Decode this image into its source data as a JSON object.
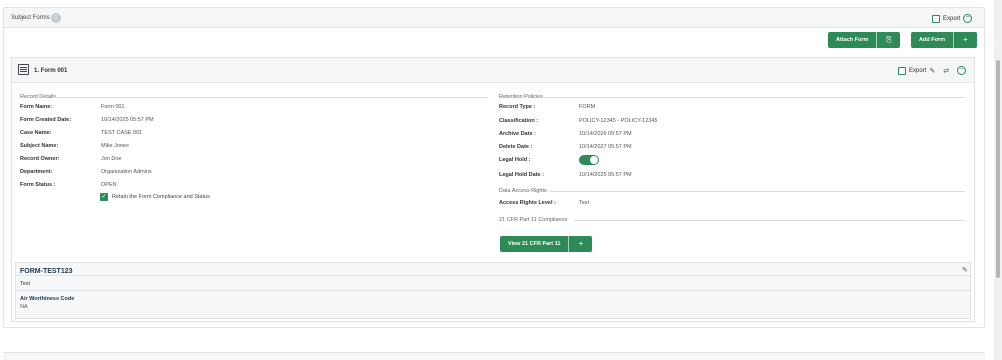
{
  "subject_forms": {
    "title": "Subject Forms",
    "count": "1",
    "export_label": "Export",
    "attach_form_label": "Attach Form",
    "add_form_label": "Add Form"
  },
  "form": {
    "title": "1. Form 001",
    "export_label": "Export",
    "record_details": {
      "heading": "Record Details",
      "fields": [
        {
          "label": "Form Name:",
          "value": "Form 001"
        },
        {
          "label": "Form Created Date:",
          "value": "10/14/2025 05:57 PM"
        },
        {
          "label": "Case Name:",
          "value": "TEST CASE 001"
        },
        {
          "label": "Subject Name:",
          "value": "Mike Jones"
        },
        {
          "label": "Record Owner:",
          "value": "Jon Doe"
        },
        {
          "label": "Department:",
          "value": "Organization Admins"
        },
        {
          "label": "Form Status :",
          "value": "OPEN"
        }
      ],
      "retain_label": "Retain the Form Compliance and Status"
    },
    "retention": {
      "heading": "Retention Policies",
      "fields": [
        {
          "label": "Record Type :",
          "value": "FORM"
        },
        {
          "label": "Classification :",
          "value": "POLICY-12345 - POLICY-12345"
        },
        {
          "label": "Archive Date :",
          "value": "10/14/2026 05:57 PM"
        },
        {
          "label": "Delete Date :",
          "value": "10/14/2027 05:57 PM"
        },
        {
          "label": "Legal Hold :",
          "value": ""
        },
        {
          "label": "Legal Hold Date :",
          "value": "10/14/2025 05:57 PM"
        }
      ],
      "legal_hold_on": true
    },
    "access": {
      "heading": "Data Access Rights",
      "label": "Access Rights Level :",
      "value": "Test"
    },
    "cfr": {
      "heading": "21 CFR Part 11 Compliance",
      "button_label": "View 21 CFR Part 11"
    },
    "sub_form": {
      "title": "FORM-TEST123",
      "subtitle": "Test",
      "field_label": "Air Worthiness Code",
      "field_value": "NA"
    }
  },
  "colors": {
    "accent": "#2e8b57",
    "header_bg": "#f4f6f7",
    "title_navy": "#223a52"
  }
}
